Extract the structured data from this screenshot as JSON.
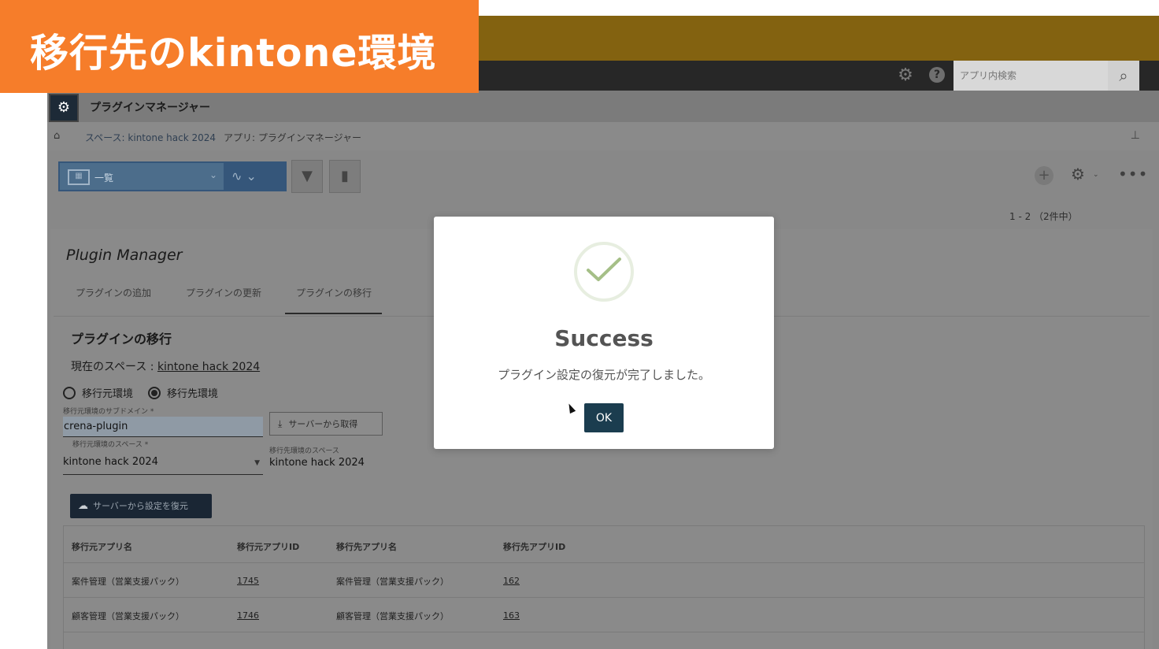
{
  "banner": {
    "text": "移行先のkintone環境"
  },
  "header": {
    "search_placeholder": "アプリ内検索",
    "help_label": "?"
  },
  "app": {
    "title": "プラグインマネージャー"
  },
  "breadcrumb": {
    "space": "スペース: kintone hack 2024",
    "app": "アプリ: プラグインマネージャー"
  },
  "toolbar": {
    "view_label": "一覧",
    "record_count": "1 - 2 （2件中）"
  },
  "plugin_manager": {
    "title": "Plugin Manager",
    "tabs": [
      {
        "label": "プラグインの追加"
      },
      {
        "label": "プラグインの更新"
      },
      {
        "label": "プラグインの移行"
      }
    ],
    "section_title": "プラグインの移行",
    "current_space_label": "現在のスペース : ",
    "current_space_value": "kintone hack 2024",
    "radio_source": "移行元環境",
    "radio_dest": "移行先環境",
    "subdomain_label": "移行元環境のサブドメイン *",
    "subdomain_value": "crena-plugin",
    "fetch_button": "サーバーから取得",
    "source_space_label": "移行元環境のスペース *",
    "source_space_value": "kintone hack 2024",
    "dest_space_label": "移行先環境のスペース",
    "dest_space_value": "kintone hack 2024",
    "restore_button": "サーバーから設定を復元"
  },
  "table": {
    "headers": [
      "移行元アプリ名",
      "移行元アプリID",
      "移行先アプリ名",
      "移行先アプリID"
    ],
    "rows": [
      [
        "案件管理（営業支援パック）",
        "1745",
        "案件管理（営業支援パック）",
        "162"
      ],
      [
        "顧客管理（営業支援パック）",
        "1746",
        "顧客管理（営業支援パック）",
        "163"
      ]
    ]
  },
  "modal": {
    "title": "Success",
    "message": "プラグイン設定の復元が完了しました。",
    "ok_label": "OK"
  },
  "colors": {
    "banner": "#f67d2a",
    "gold_bar": "#836210",
    "modal_button": "#1b3d4f",
    "restore_button": "#1a2634"
  }
}
